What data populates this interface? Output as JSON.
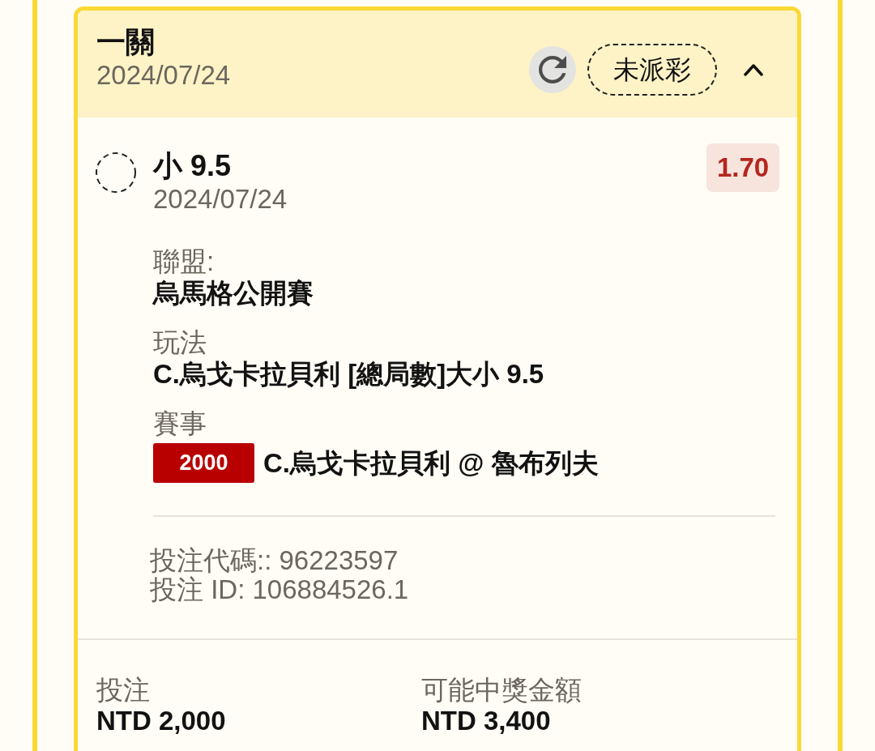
{
  "bet_card": {
    "header": {
      "title": "一關",
      "date": "2024/07/24",
      "status": "未派彩",
      "expanded": true
    },
    "selection": {
      "name": "小 9.5",
      "date": "2024/07/24",
      "odds": "1.70"
    },
    "details": [
      {
        "label": "聯盟:",
        "value": "烏馬格公開賽"
      },
      {
        "label": "玩法",
        "value": "C.烏戈卡拉貝利 [總局數]大小 9.5"
      },
      {
        "label": "賽事",
        "badge": "2000",
        "value": "C.烏戈卡拉貝利 @ 魯布列夫"
      }
    ],
    "bet_codes": [
      "投注代碼:: 96223597",
      "投注 ID: 106884526.1"
    ],
    "summary": [
      {
        "label": "投注",
        "value": "NTD 2,000"
      },
      {
        "label": "可能中獎金額",
        "value": "NTD 3,400"
      }
    ]
  }
}
